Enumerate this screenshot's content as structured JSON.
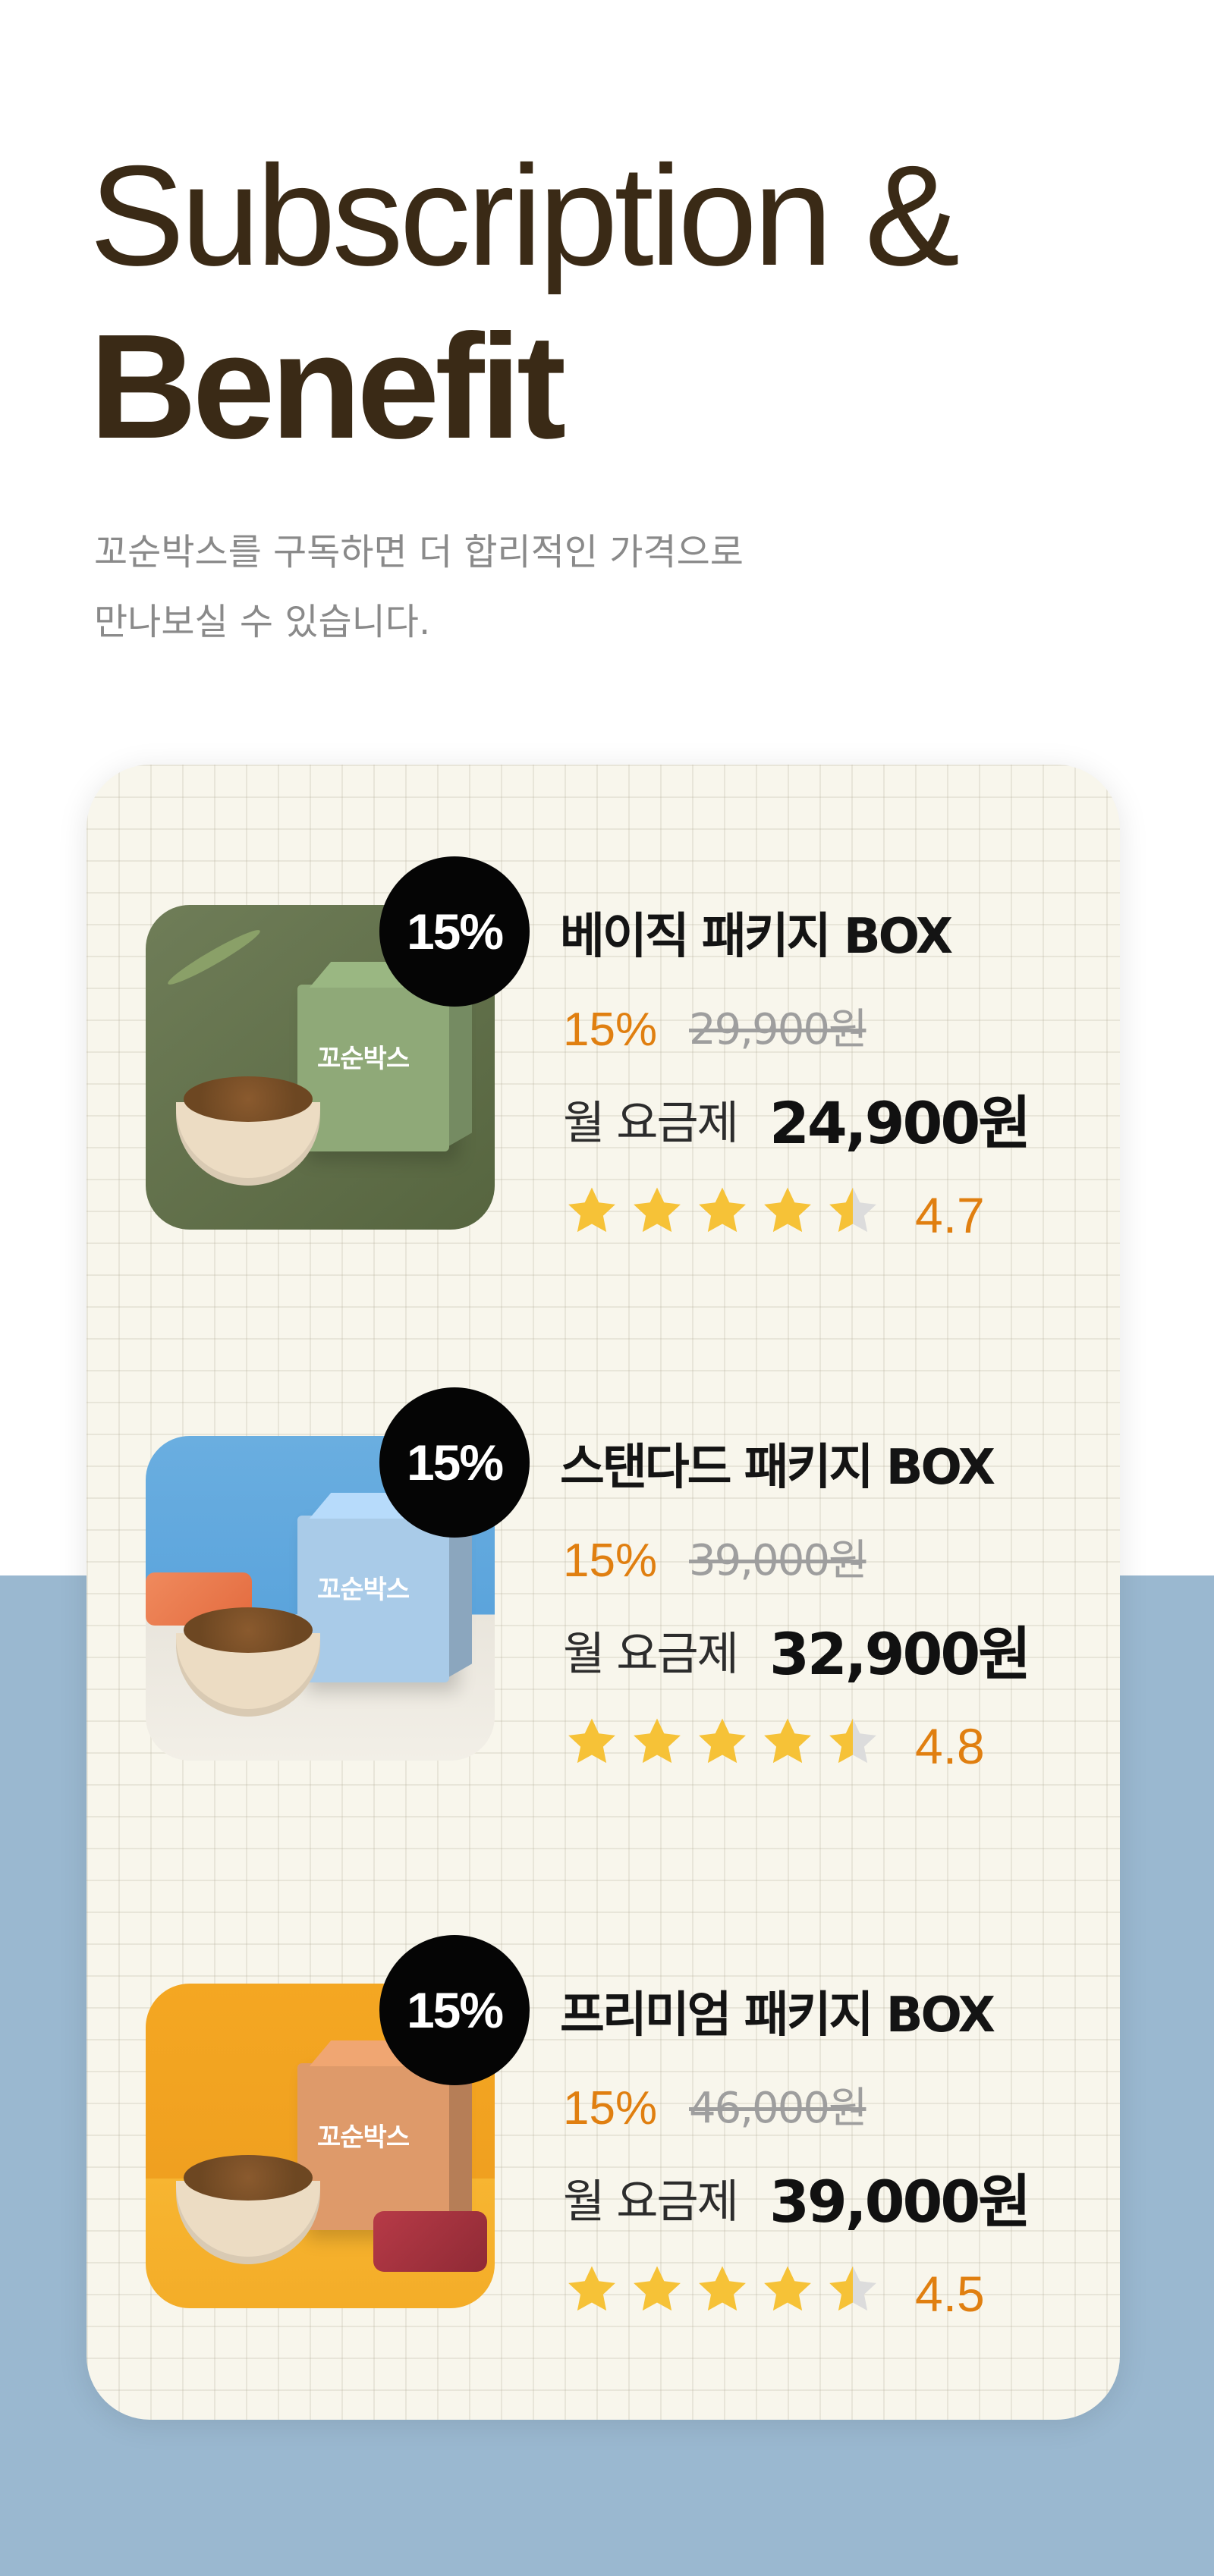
{
  "header": {
    "title_line1": "Subscription &",
    "title_line2": "Benefit",
    "subtitle_line1": "꼬순박스를 구독하면 더 합리적인 가격으로",
    "subtitle_line2": "만나보실 수 있습니다."
  },
  "colors": {
    "accent": "#e07f10",
    "title": "#3a2a16",
    "band": "#9ab8d0",
    "star": "#f6c237",
    "star_empty": "#dcdcdc"
  },
  "products": [
    {
      "badge": "15%",
      "name": "베이직 패키지 BOX",
      "discount": "15%",
      "original_price": "29,900원",
      "plan_label": "월 요금제",
      "price": "24,900원",
      "rating_text": "4.7",
      "rating": 4.7,
      "box_logo": "꼬순박스",
      "theme": "green"
    },
    {
      "badge": "15%",
      "name": "스탠다드 패키지 BOX",
      "discount": "15%",
      "original_price": "39,000원",
      "plan_label": "월 요금제",
      "price": "32,900원",
      "rating_text": "4.8",
      "rating": 4.8,
      "box_logo": "꼬순박스",
      "theme": "blue"
    },
    {
      "badge": "15%",
      "name": "프리미엄 패키지 BOX",
      "discount": "15%",
      "original_price": "46,000원",
      "plan_label": "월 요금제",
      "price": "39,000원",
      "rating_text": "4.5",
      "rating": 4.5,
      "box_logo": "꼬순박스",
      "theme": "orange"
    }
  ]
}
